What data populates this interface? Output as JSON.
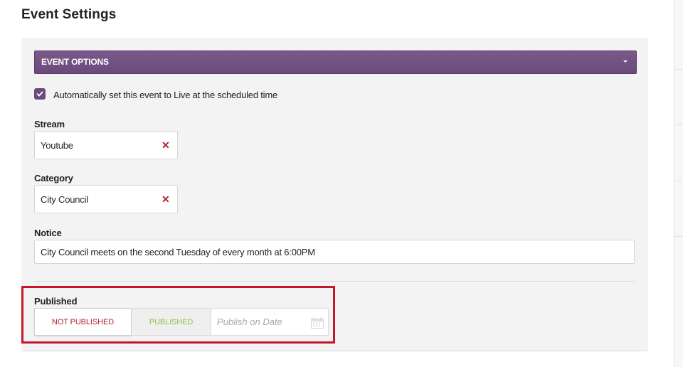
{
  "page": {
    "title": "Event Settings"
  },
  "event_options": {
    "header": "EVENT OPTIONS",
    "auto_live": {
      "checked": true,
      "label": "Automatically set this event to Live at the scheduled time"
    },
    "stream": {
      "label": "Stream",
      "value": "Youtube"
    },
    "category": {
      "label": "Category",
      "value": "City Council"
    },
    "notice": {
      "label": "Notice",
      "value": "City Council meets on the second Tuesday of every month at 6:00PM"
    },
    "published": {
      "label": "Published",
      "not_published": "NOT PUBLISHED",
      "published": "PUBLISHED",
      "selected": "NOT PUBLISHED",
      "date_placeholder": "Publish on Date"
    }
  },
  "colors": {
    "header_purple": "#6b4a7c",
    "checkbox_purple": "#6b4a7c",
    "clear_red": "#b5202e",
    "highlight_red": "#c4172c",
    "not_published_text": "#b5202e",
    "published_text": "#8cbf4a"
  },
  "icons": {
    "caret": "chevron-down-icon",
    "check": "checkmark-icon",
    "clear": "close-icon",
    "calendar": "calendar-icon"
  }
}
